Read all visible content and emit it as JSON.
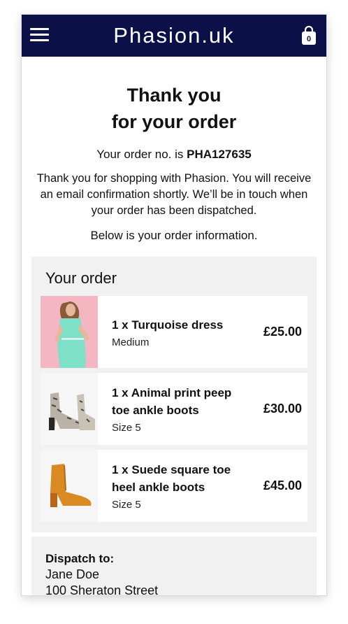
{
  "header": {
    "brand": "Phasion.uk",
    "cart_count": "0",
    "menu_icon": "hamburger-menu-icon",
    "bag_icon": "shopping-bag-icon",
    "background_color": "#0b1148"
  },
  "confirmation": {
    "title_line1": "Thank you",
    "title_line2": "for your order",
    "order_no_prefix": "Your order no. is ",
    "order_no": "PHA127635",
    "message": "Thank you for shopping with Phasion. You will receive an email confirmation shortly. We’ll be in touch when your order has been dispatched.",
    "below_text": "Below is your order information."
  },
  "order": {
    "title": "Your order",
    "items": [
      {
        "title": "1 x Turquoise dress",
        "variant": "Medium",
        "price": "£25.00"
      },
      {
        "title": "1 x Animal print peep toe ankle boots",
        "variant": "Size 5",
        "price": "£30.00"
      },
      {
        "title": "1 x Suede square toe heel ankle boots",
        "variant": "Size 5",
        "price": "£45.00"
      }
    ]
  },
  "dispatch": {
    "label": "Dispatch to:",
    "name": "Jane Doe",
    "street": "100 Sheraton Street"
  }
}
